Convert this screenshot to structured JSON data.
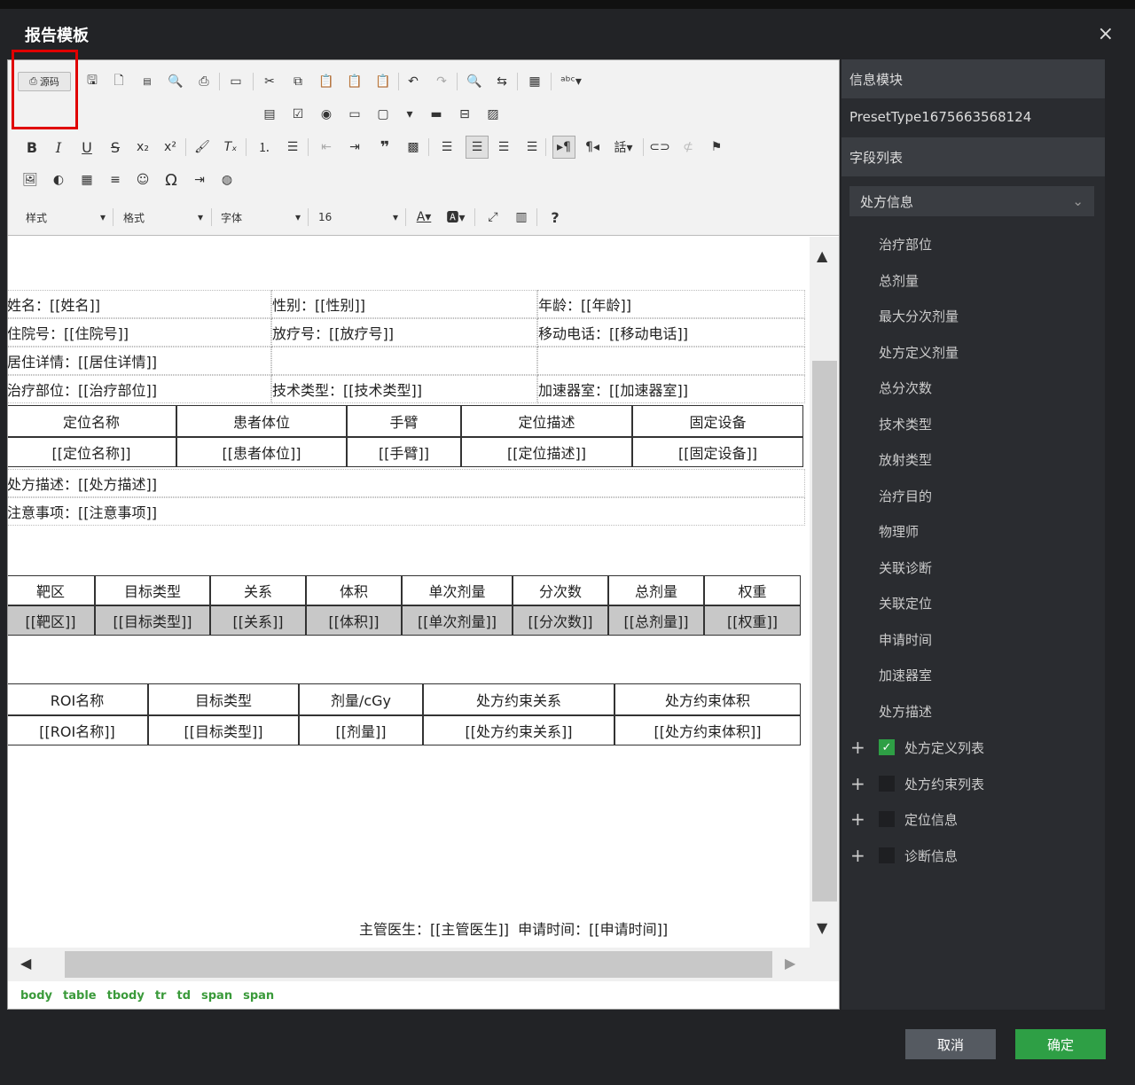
{
  "dialog": {
    "title": "报告模板",
    "close": "×"
  },
  "toolbar": {
    "source_label": "源码",
    "styles_label": "样式",
    "format_label": "格式",
    "font_label": "字体",
    "size_label": "16",
    "help_label": "?"
  },
  "content": {
    "info_rows": [
      [
        "姓名：[[姓名]]",
        "性别：[[性别]]",
        "年龄：[[年龄]]"
      ],
      [
        "住院号：[[住院号]]",
        "放疗号：[[放疗号]]",
        "移动电话：[[移动电话]]"
      ],
      [
        "居住详情：[[居住详情]]",
        "",
        ""
      ],
      [
        "治疗部位：[[治疗部位]]",
        "技术类型：[[技术类型]]",
        "加速器室：[[加速器室]]"
      ]
    ],
    "pos_table": {
      "headers": [
        "定位名称",
        "患者体位",
        "手臂",
        "定位描述",
        "固定设备"
      ],
      "values": [
        "[[定位名称]]",
        "[[患者体位]]",
        "[[手臂]]",
        "[[定位描述]]",
        "[[固定设备]]"
      ]
    },
    "rx_desc": "处方描述：[[处方描述]]",
    "notes": "注意事项：[[注意事项]]",
    "target_table": {
      "headers": [
        "靶区",
        "目标类型",
        "关系",
        "体积",
        "单次剂量",
        "分次数",
        "总剂量",
        "权重"
      ],
      "values": [
        "[[靶区]]",
        "[[目标类型]]",
        "[[关系]]",
        "[[体积]]",
        "[[单次剂量]]",
        "[[分次数]]",
        "[[总剂量]]",
        "[[权重]]"
      ]
    },
    "roi_table": {
      "headers": [
        "ROI名称",
        "目标类型",
        "剂量/cGy",
        "处方约束关系",
        "处方约束体积"
      ],
      "values": [
        "[[ROI名称]]",
        "[[目标类型]]",
        "[[剂量]]",
        "[[处方约束关系]]",
        "[[处方约束体积]]"
      ]
    },
    "footer_line": "主管医生：[[主管医生]]  申请时间：[[申请时间]]"
  },
  "path": [
    "body",
    "table",
    "tbody",
    "tr",
    "td",
    "span",
    "span"
  ],
  "right": {
    "info_header": "信息模块",
    "preset": "PresetType1675663568124",
    "field_header": "字段列表",
    "select_value": "处方信息",
    "fields": [
      "治疗部位",
      "总剂量",
      "最大分次剂量",
      "处方定义剂量",
      "总分次数",
      "技术类型",
      "放射类型",
      "治疗目的",
      "物理师",
      "关联诊断",
      "关联定位",
      "申请时间",
      "加速器室",
      "处方描述"
    ],
    "groups": [
      {
        "label": "处方定义列表",
        "checked": true
      },
      {
        "label": "处方约束列表",
        "checked": false
      },
      {
        "label": "定位信息",
        "checked": false
      },
      {
        "label": "诊断信息",
        "checked": false
      }
    ]
  },
  "buttons": {
    "cancel": "取消",
    "ok": "确定"
  },
  "colors": {
    "ok": "#2e9f45",
    "cancel": "#555a61",
    "highlight": "#e00000"
  }
}
